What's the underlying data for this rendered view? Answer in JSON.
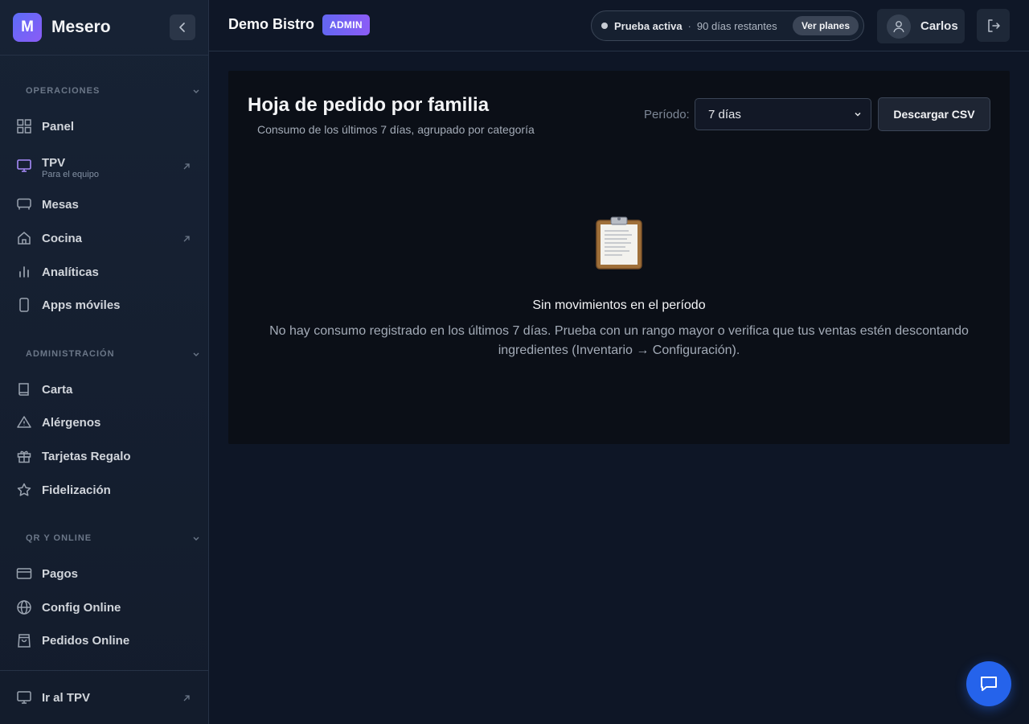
{
  "brand": {
    "initial": "M",
    "name": "Mesero"
  },
  "sidebar": {
    "sections": [
      {
        "title": "OPERACIONES",
        "items": [
          {
            "label": "Panel",
            "icon": "grid-icon"
          },
          {
            "label": "TPV",
            "sublabel": "Para el equipo",
            "icon": "monitor-icon",
            "external": true,
            "active": true
          },
          {
            "label": "Mesas",
            "icon": "table-icon"
          },
          {
            "label": "Cocina",
            "icon": "house-icon",
            "external": true
          },
          {
            "label": "Analíticas",
            "icon": "bar-chart-icon"
          },
          {
            "label": "Apps móviles",
            "icon": "smartphone-icon"
          }
        ]
      },
      {
        "title": "ADMINISTRACIÓN",
        "items": [
          {
            "label": "Carta",
            "icon": "book-icon"
          },
          {
            "label": "Alérgenos",
            "icon": "warning-icon"
          },
          {
            "label": "Tarjetas Regalo",
            "icon": "gift-icon"
          },
          {
            "label": "Fidelización",
            "icon": "star-icon"
          }
        ]
      },
      {
        "title": "QR Y ONLINE",
        "items": [
          {
            "label": "Pagos",
            "icon": "credit-card-icon"
          },
          {
            "label": "Config Online",
            "icon": "globe-icon"
          },
          {
            "label": "Pedidos Online",
            "icon": "shopping-bag-icon"
          }
        ]
      }
    ],
    "bottom_item": {
      "label": "Ir al TPV",
      "icon": "monitor-icon",
      "external": true
    }
  },
  "header": {
    "business_name": "Demo Bistro",
    "role_badge": "ADMIN",
    "trial_status": "Prueba activa",
    "trial_separator": "·",
    "trial_days": "90 días restantes",
    "plans_button": "Ver planes",
    "user_name": "Carlos"
  },
  "report": {
    "title": "Hoja de pedido por familia",
    "subtitle": "Consumo de los últimos 7 días, agrupado por categoría",
    "period_label": "Período:",
    "period_value": "7 días",
    "download_button": "Descargar CSV",
    "empty_icon": "clipboard-icon",
    "empty_title": "Sin movimientos en el período",
    "empty_description": "No hay consumo registrado en los últimos 7 días. Prueba con un rango mayor o verifica que tus ventas estén descontando ingredientes (Inventario → Configuración)."
  },
  "colors": {
    "accent": "#6366f1",
    "active_icon": "#a78bfa",
    "chat_fab": "#2563eb"
  }
}
